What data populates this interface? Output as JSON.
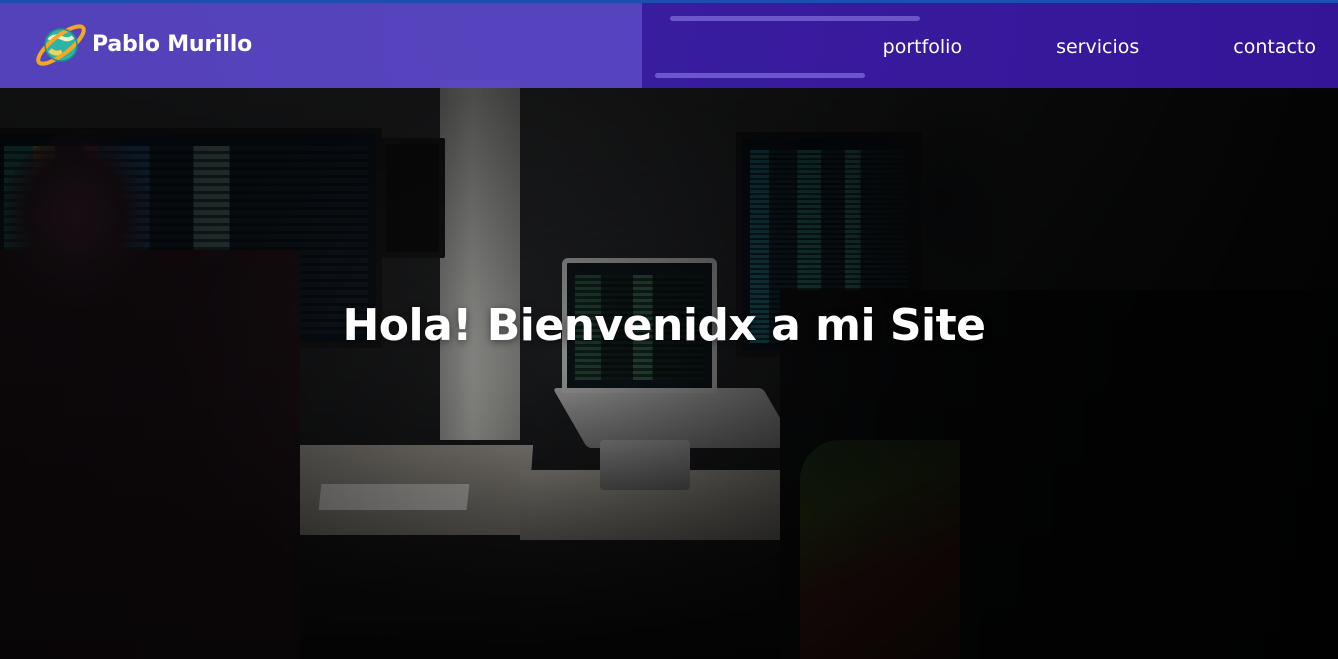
{
  "brand": {
    "name": "Pablo Murillo",
    "logo_icon": "planet-ring-logo-icon",
    "colors": {
      "navbar": "#5a46c8",
      "navbar_right": "#37169f",
      "ring": "#f5a623",
      "planet": "#2bb5a8"
    }
  },
  "nav": {
    "items": [
      {
        "label": "portfolio"
      },
      {
        "label": "servicios"
      },
      {
        "label": "contacto"
      }
    ]
  },
  "hero": {
    "headline": "Hola! Bienvenidx a mi Site"
  }
}
